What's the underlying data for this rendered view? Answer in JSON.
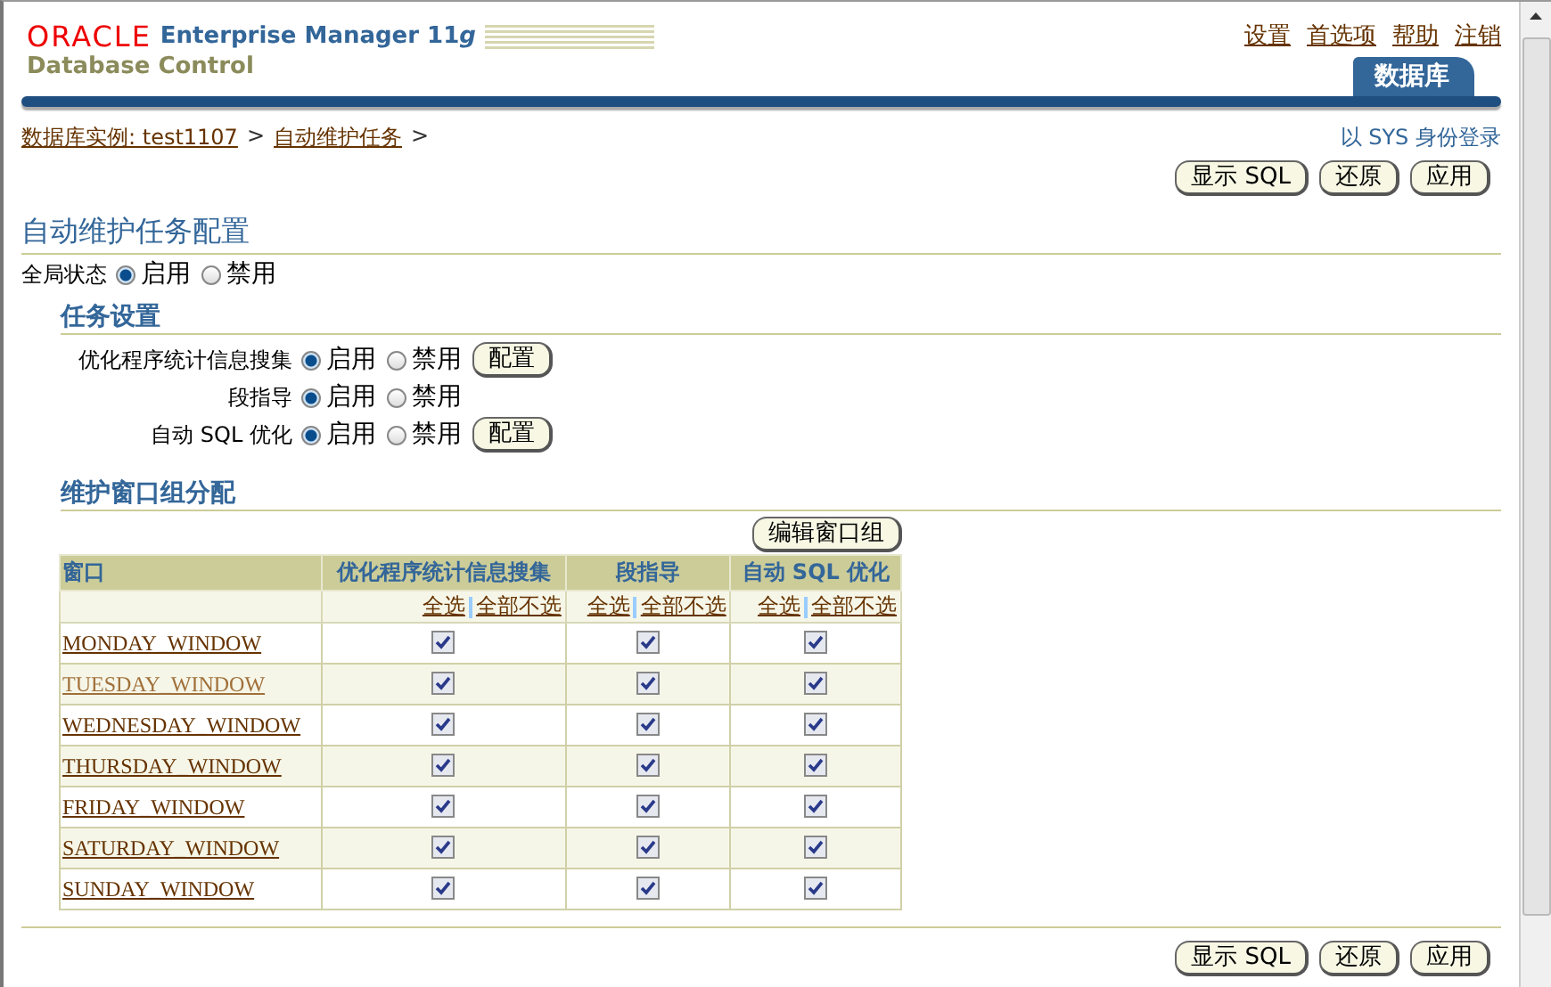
{
  "header": {
    "logo": "ORACLE",
    "product": "Enterprise Manager 11",
    "product_suffix": "g",
    "subtitle": "Database Control",
    "global_links": [
      "设置",
      "首选项",
      "帮助",
      "注销"
    ],
    "tabs": [
      {
        "label": "数据库",
        "selected": true
      }
    ]
  },
  "breadcrumb": {
    "items": [
      "数据库实例: test1107",
      "自动维护任务"
    ],
    "separator": ">"
  },
  "login_info": "以 SYS 身份登录",
  "top_buttons": [
    "显示 SQL",
    "还原",
    "应用"
  ],
  "title": "自动维护任务配置",
  "global_status": {
    "label": "全局状态",
    "options": [
      {
        "label": "启用",
        "selected": true
      },
      {
        "label": "禁用",
        "selected": false
      }
    ]
  },
  "task_settings": {
    "title": "任务设置",
    "tasks": [
      {
        "label": "优化程序统计信息搜集",
        "options": [
          {
            "label": "启用",
            "selected": true
          },
          {
            "label": "禁用",
            "selected": false
          }
        ],
        "button": "配置"
      },
      {
        "label": "段指导",
        "options": [
          {
            "label": "启用",
            "selected": true
          },
          {
            "label": "禁用",
            "selected": false
          }
        ]
      },
      {
        "label": "自动 SQL 优化",
        "options": [
          {
            "label": "启用",
            "selected": true
          },
          {
            "label": "禁用",
            "selected": false
          }
        ],
        "button": "配置"
      }
    ]
  },
  "window_groups": {
    "title": "维护窗口组分配",
    "edit_button": "编辑窗口组",
    "first_column": "窗口",
    "columns": [
      {
        "label": "优化程序统计信息搜集",
        "select_all": "全选",
        "deselect_all": "全部不选"
      },
      {
        "label": "段指导",
        "select_all": "全选",
        "deselect_all": "全部不选"
      },
      {
        "label": "自动 SQL 优化",
        "select_all": "全选",
        "deselect_all": "全部不选"
      }
    ],
    "rows": [
      {
        "name": "MONDAY_WINDOW",
        "visited": false,
        "checks": [
          true,
          true,
          true
        ]
      },
      {
        "name": "TUESDAY_WINDOW",
        "visited": true,
        "checks": [
          true,
          true,
          true
        ]
      },
      {
        "name": "WEDNESDAY_WINDOW",
        "visited": false,
        "checks": [
          true,
          true,
          true
        ]
      },
      {
        "name": "THURSDAY_WINDOW",
        "visited": false,
        "checks": [
          true,
          true,
          true
        ]
      },
      {
        "name": "FRIDAY_WINDOW",
        "visited": false,
        "checks": [
          true,
          true,
          true
        ]
      },
      {
        "name": "SATURDAY_WINDOW",
        "visited": false,
        "checks": [
          true,
          true,
          true
        ]
      },
      {
        "name": "SUNDAY_WINDOW",
        "visited": false,
        "checks": [
          true,
          true,
          true
        ]
      }
    ]
  },
  "bottom_buttons": [
    "显示 SQL",
    "还原",
    "应用"
  ]
}
